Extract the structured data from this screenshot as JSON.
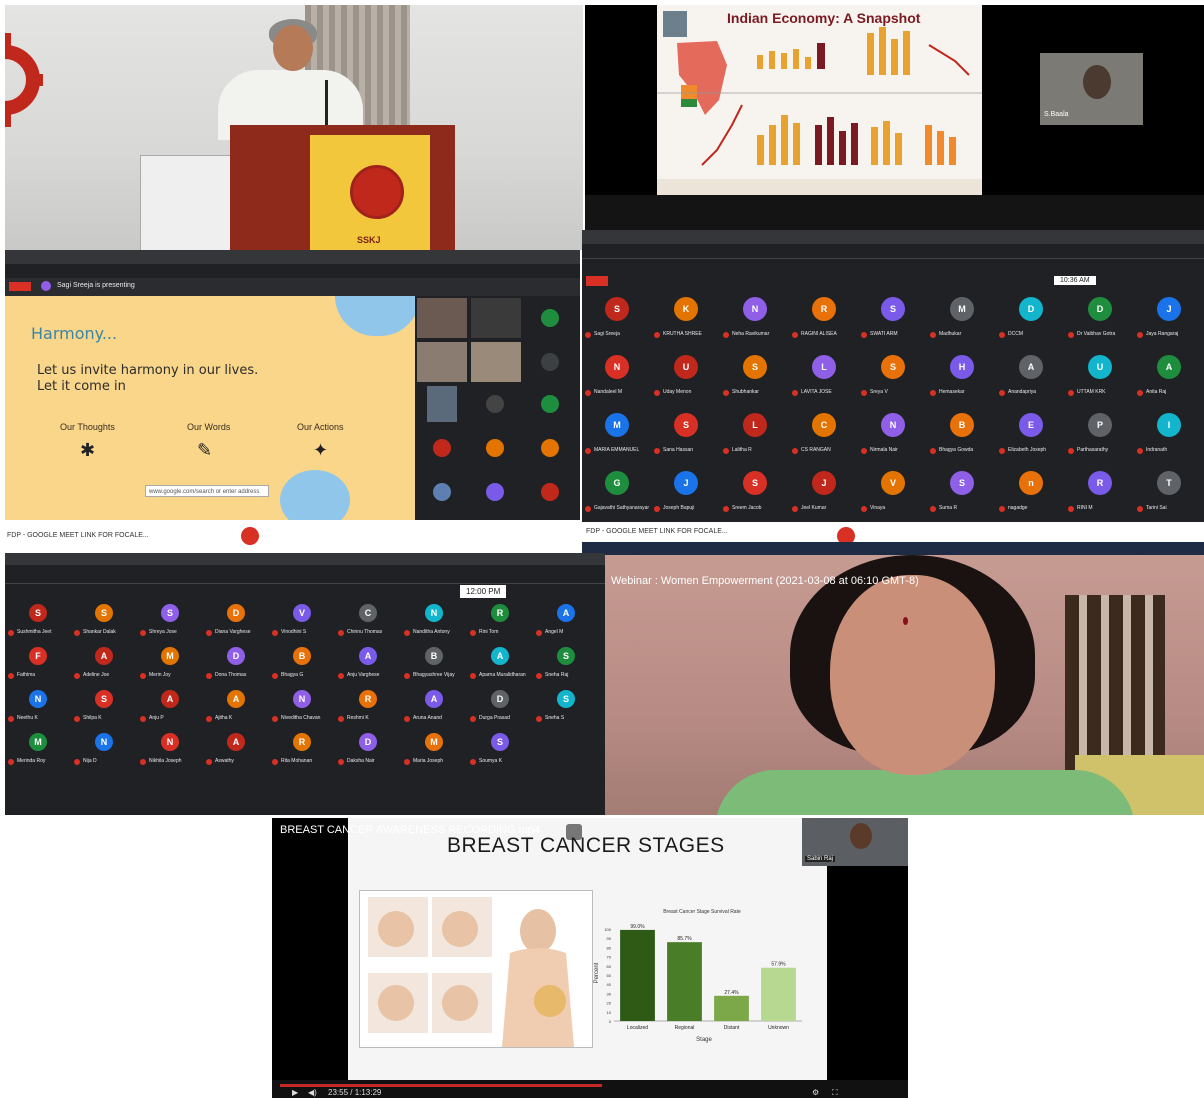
{
  "panel1": {
    "logo_text": "SSKJ"
  },
  "panel2": {
    "infographic_title": "Indian Economy: A Snapshot",
    "cam_name": "S.Baala"
  },
  "panel3": {
    "tab_title": "Sagi Sreeja is presenting",
    "slide_title": "Harmony...",
    "line1": "Let us invite harmony in our lives.",
    "line2": "Let it come in",
    "labels": [
      "Our Thoughts",
      "Our Words",
      "Our Actions"
    ],
    "search_placeholder": "www.google.com/search or enter address",
    "meeting_label": "FDP - GOOGLE MEET LINK FOR FOCALE..."
  },
  "panel4": {
    "clock": "10:36 AM",
    "meeting_label": "FDP - GOOGLE MEET LINK FOR FOCALE...",
    "participants": [
      "Sagi Sreeja",
      "KRUTHA SHREE",
      "Neha Ravikumar",
      "RAGINI ALISEA",
      "SWATI ARM",
      "Madhukar",
      "DCCM",
      "Dr Vaibhav Gotra",
      "Jaya Rangaraj",
      "Nandaleel M",
      "Uday Menon",
      "Shubhankar",
      "LAVITA JOSE",
      "Sreya V",
      "Hemasekar",
      "Anandapriya",
      "UTTAM KRK",
      "Anita Raj",
      "MARIA EMMANUEL",
      "Sana Hassan",
      "Lalitha R",
      "CS RANGAN",
      "Nirmala Nair",
      "Bhagya Gowda",
      "Elizabeth Joseph",
      "Parthasarathy",
      "Indranath",
      "Gajavathi Sathyanarayan",
      "Joseph Bapuji",
      "Sreem Jacob",
      "Jeel Kumar",
      "Vinaya",
      "Suma R",
      "nagadge",
      "RINI M",
      "Tarini Sai"
    ]
  },
  "panel5": {
    "clock": "12:00 PM",
    "participants": [
      "Sushmitha Jeet",
      "Shankar Dalak",
      "Shreya Jose",
      "Diana Varghese",
      "Vinodhini S",
      "Chinnu Thomas",
      "Nanditha Antony",
      "Rini Tom",
      "Angel M",
      "Fathima",
      "Adeline Joe",
      "Merin Joy",
      "Dona Thomas",
      "Bhagya G",
      "Anju Varghese",
      "Bhagyashree Vijay",
      "Aparna Muralidharan",
      "Sneha Raj",
      "Neethu K",
      "Shilpa K",
      "Anju P",
      "Ajitha K",
      "Niveditha Chavan",
      "Reshmi K",
      "Aruna Anand",
      "Durga Prasad",
      "Sneha S",
      "Merinda Roy",
      "Nija D",
      "Nikhila Joseph",
      "Aswathy",
      "Rita Mohanan",
      "Daksha Nair",
      "Maria Joseph",
      "Soumya K"
    ]
  },
  "panel6": {
    "caption": "Webinar : Women Empowerment (2021-03-08 at 06:10 GMT-8)"
  },
  "panel7": {
    "video_title": "BREAST CANCER AWARENESS RECORDING.mp4",
    "slide_title": "BREAST CANCER STAGES",
    "cam_name": "Sabin Raj",
    "time": "23:55 / 1:13:29"
  },
  "chart_data": {
    "type": "bar",
    "title": "Breast Cancer Stage Survival Rate",
    "xlabel": "Stage",
    "ylabel": "Percent",
    "categories": [
      "Localized",
      "Regional",
      "Distant",
      "Unknown"
    ],
    "values": [
      99.0,
      85.7,
      27.4,
      57.9
    ],
    "value_labels": [
      "99.0%",
      "85.7%",
      "27.4%",
      "57.9%"
    ],
    "ylim": [
      0,
      100
    ],
    "yticks": [
      "100",
      "90",
      "80",
      "70",
      "60",
      "50",
      "40",
      "30",
      "20",
      "10",
      "0"
    ],
    "colors": [
      "#2e5a16",
      "#4a7d27",
      "#7da84a",
      "#b7d890"
    ]
  }
}
